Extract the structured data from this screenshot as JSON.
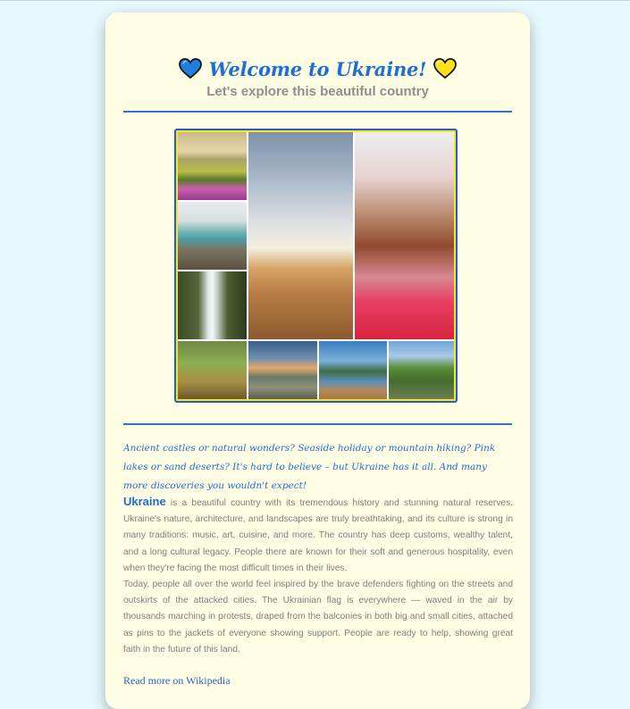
{
  "header": {
    "title": "Welcome to Ukraine!",
    "subtitle": "Let's explore this beautiful country"
  },
  "colors": {
    "page_bg": "#e6f9fd",
    "card_bg": "#fffde3",
    "accent_blue": "#1f6dd0",
    "flag_blue": "#0057b7",
    "flag_yellow": "#ffd700",
    "text_gray": "#7f7f7f"
  },
  "icons": {
    "left": "blue-heart-icon",
    "right": "yellow-heart-icon"
  },
  "gallery": {
    "tiles": [
      "mountain-meadow-photo",
      "seaside-coast-photo",
      "waterfall-photo",
      "desert-dunes-photo",
      "pink-lake-photo",
      "deer-in-forest-photo",
      "river-canyon-photo",
      "mountain-lake-photo",
      "green-cliff-photo"
    ]
  },
  "intro": "Ancient castles or natural wonders? Seaside holiday or mountain hiking? Pink lakes or sand deserts? It's hard to believe – but Ukraine has it all. And many more discoveries you wouldn't expect!",
  "body": {
    "lead": "Ukraine",
    "p1_rest": " is a beautiful country with its tremendous history and stunning natural reserves. Ukraine's nature, architecture, and landscapes are truly breathtaking, and its culture is strong in many traditions: music, art, cuisine, and more. The country has deep customs, wealthy talent, and a long cultural legacy. People there are known for their soft and generous hospitality, even when they're facing the most difficult times in their lives.",
    "p2": "Today, people all over the world feel inspired by the brave defenders fighting on the streets and outskirts of the attacked cities. The Ukrainian flag is everywhere — waved in the air by thousands marching in protests, draped from the balconies in both big and small cities, attached as pins to the jackets of everyone showing support. People are ready to help, showing great faith in the future of this land."
  },
  "link": {
    "label": "Read more on Wikipedia"
  }
}
